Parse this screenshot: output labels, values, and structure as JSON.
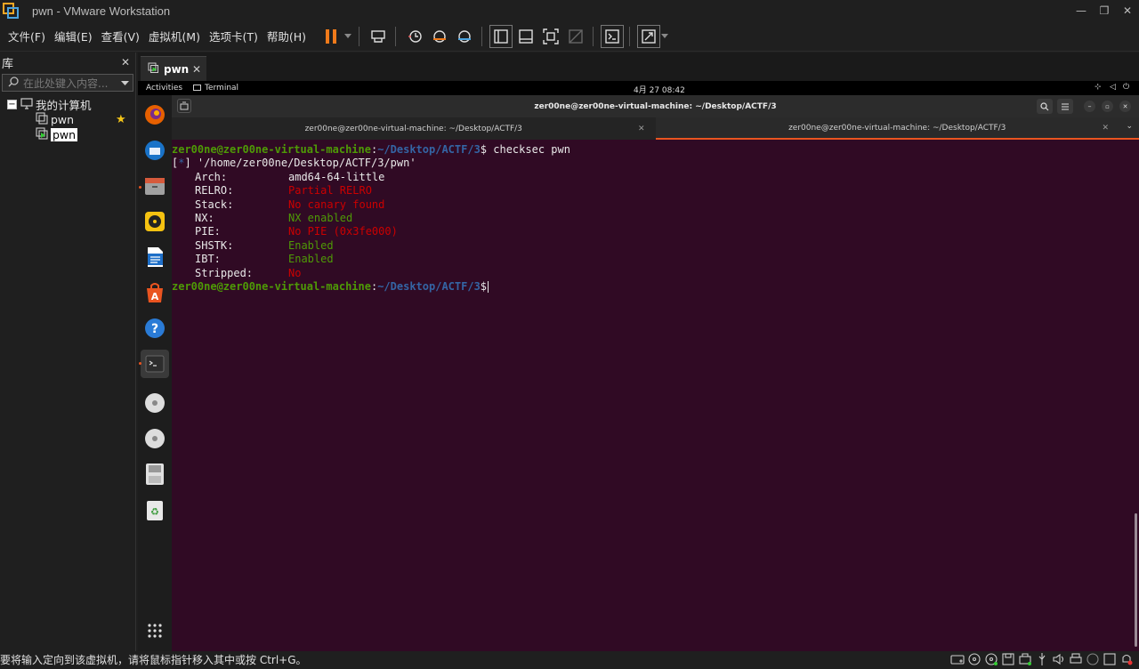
{
  "window": {
    "title": "pwn - VMware Workstation"
  },
  "menu": [
    "文件(F)",
    "编辑(E)",
    "查看(V)",
    "虚拟机(M)",
    "选项卡(T)",
    "帮助(H)"
  ],
  "library": {
    "title": "库",
    "search_placeholder": "在此处键入内容...",
    "root": "我的计算机",
    "items": [
      "pwn",
      "pwn"
    ]
  },
  "vm_tab": {
    "label": "pwn"
  },
  "gnome": {
    "activities": "Activities",
    "app": "Terminal",
    "clock": "4月 27  08:42"
  },
  "terminal": {
    "title": "zer00ne@zer00ne-virtual-machine: ~/Desktop/ACTF/3",
    "tabs": [
      "zer00ne@zer00ne-virtual-machine: ~/Desktop/ACTF/3",
      "zer00ne@zer00ne-virtual-machine: ~/Desktop/ACTF/3"
    ],
    "prompt_user": "zer00ne@zer00ne-virtual-machine",
    "prompt_path": "~/Desktop/ACTF/3",
    "command": " checksec pwn",
    "info_line": "'/home/zer00ne/Desktop/ACTF/3/pwn'",
    "info_marker": "*",
    "rows": [
      {
        "key": "Arch:",
        "value": "amd64-64-little",
        "color": "#e8e8e8"
      },
      {
        "key": "RELRO:",
        "value": "Partial RELRO",
        "color": "#cc0000"
      },
      {
        "key": "Stack:",
        "value": "No canary found",
        "color": "#cc0000"
      },
      {
        "key": "NX:",
        "value": "NX enabled",
        "color": "#4e9a06"
      },
      {
        "key": "PIE:",
        "value": "No PIE (0x3fe000)",
        "color": "#cc0000"
      },
      {
        "key": "SHSTK:",
        "value": "Enabled",
        "color": "#4e9a06"
      },
      {
        "key": "IBT:",
        "value": "Enabled",
        "color": "#4e9a06"
      },
      {
        "key": "Stripped:",
        "value": "No",
        "color": "#cc0000"
      }
    ]
  },
  "status": {
    "text": "要将输入定向到该虚拟机，请将鼠标指针移入其中或按 Ctrl+G。"
  }
}
